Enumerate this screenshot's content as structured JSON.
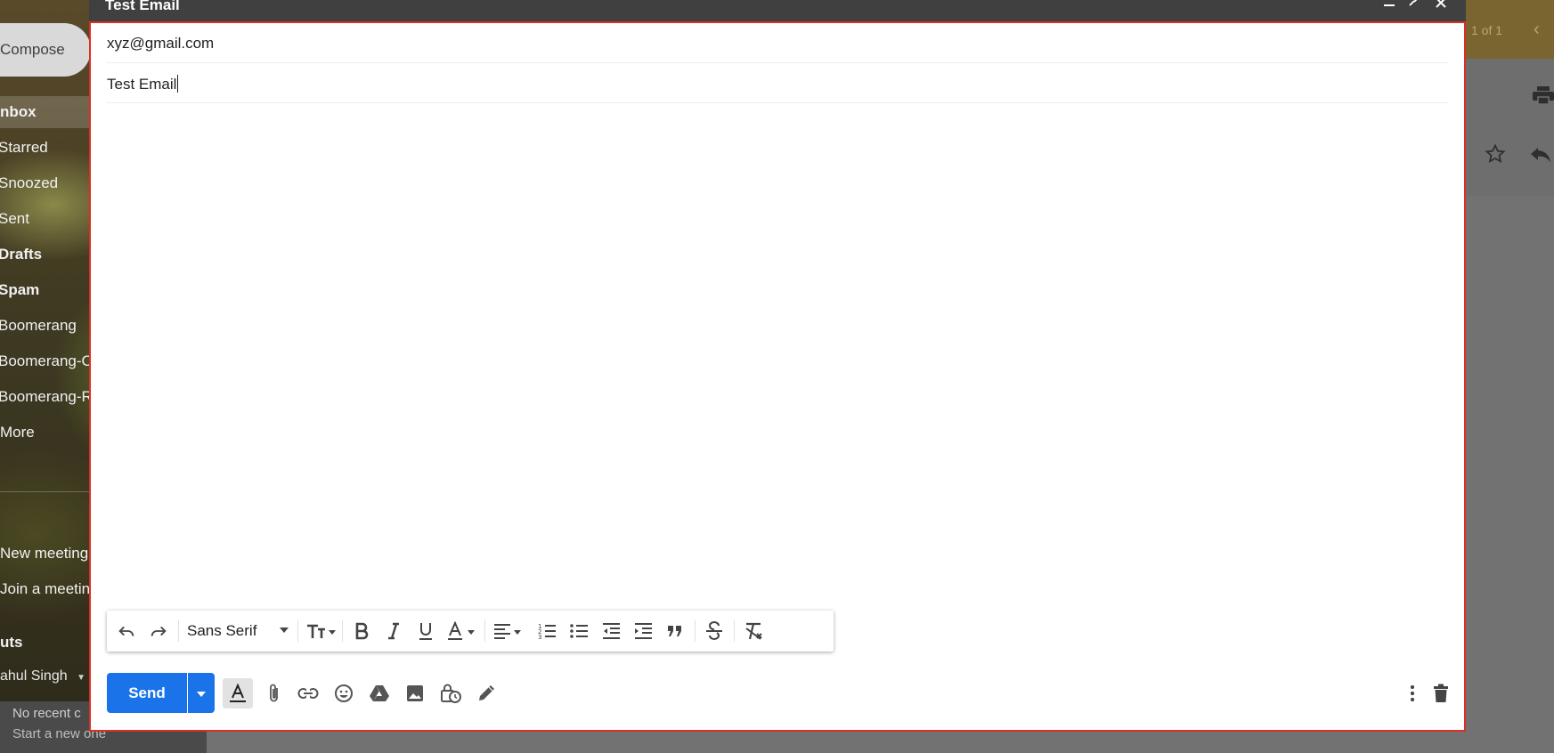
{
  "sidebar": {
    "compose_label": "Compose",
    "items": [
      {
        "label": "nbox",
        "bold": true
      },
      {
        "label": "Starred",
        "bold": false
      },
      {
        "label": "Snoozed",
        "bold": false
      },
      {
        "label": "Sent",
        "bold": false
      },
      {
        "label": "Drafts",
        "bold": true
      },
      {
        "label": "Spam",
        "bold": true
      },
      {
        "label": "Boomerang",
        "bold": false
      },
      {
        "label": "Boomerang-O",
        "bold": false
      },
      {
        "label": "Boomerang-R",
        "bold": false
      },
      {
        "label": "More",
        "bold": false
      }
    ],
    "meet": {
      "new_meeting": "New meeting",
      "join_meeting": "Join a meetin"
    },
    "hangouts": {
      "heading": "uts",
      "user": "ahul Singh",
      "no_recent": "No recent c",
      "start_new": "Start a new one"
    }
  },
  "background": {
    "pager": "1 of 1"
  },
  "compose": {
    "title": "Test Email",
    "to_value": "xyz@gmail.com",
    "subject_value": "Test Email",
    "toolbar": {
      "font_family": "Sans Serif"
    },
    "send_label": "Send",
    "colors": {
      "send_button": "#1a73e8",
      "focus_border": "#d93025",
      "header": "#404040"
    },
    "icons": [
      "undo-icon",
      "redo-icon",
      "font-size-icon",
      "bold-icon",
      "italic-icon",
      "underline-icon",
      "text-color-icon",
      "align-icon",
      "numbered-list-icon",
      "bulleted-list-icon",
      "indent-less-icon",
      "indent-more-icon",
      "quote-icon",
      "strikethrough-icon",
      "remove-formatting-icon",
      "attach-icon",
      "link-icon",
      "emoji-icon",
      "drive-icon",
      "photo-icon",
      "confidential-mode-icon",
      "signature-icon",
      "more-options-icon",
      "discard-draft-icon"
    ]
  }
}
